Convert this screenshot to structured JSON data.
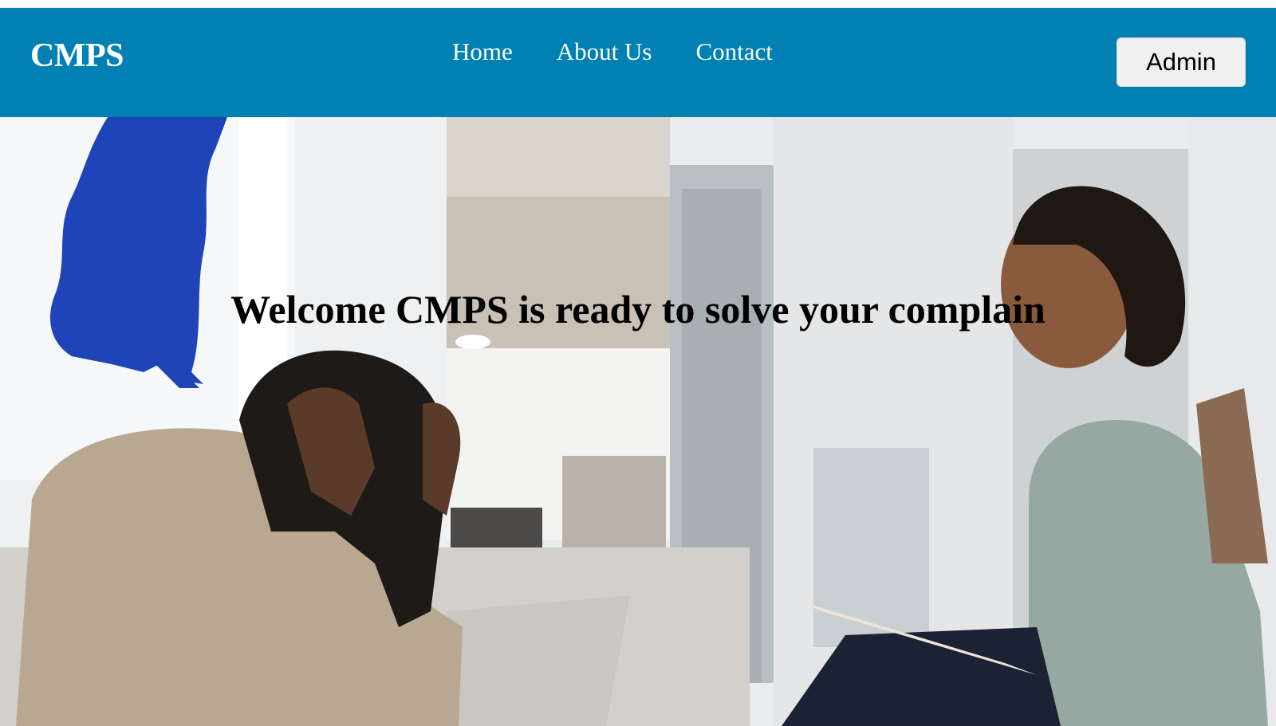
{
  "navbar": {
    "brand": "CMPS",
    "links": [
      "Home",
      "About Us",
      "Contact"
    ],
    "admin_label": "Admin",
    "bg_color": "#0181b3"
  },
  "hero": {
    "title": "Welcome CMPS is ready to solve your complain",
    "image_icon": "hero-photo-illustration"
  }
}
